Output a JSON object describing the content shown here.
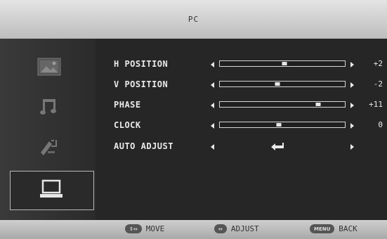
{
  "header": {
    "title": "PC"
  },
  "sidebar": {
    "items": [
      {
        "icon": "picture-icon"
      },
      {
        "icon": "music-icon"
      },
      {
        "icon": "tools-icon"
      },
      {
        "icon": "laptop-icon",
        "selected": true
      }
    ]
  },
  "menu": {
    "rows": [
      {
        "label": "H POSITION",
        "value": "+2",
        "level": 0.52
      },
      {
        "label": "V POSITION",
        "value": "-2",
        "level": 0.46
      },
      {
        "label": "PHASE",
        "value": "+11",
        "level": 0.8
      },
      {
        "label": "CLOCK",
        "value": "0",
        "level": 0.47
      },
      {
        "label": "AUTO ADJUST",
        "value": ""
      }
    ]
  },
  "footer": {
    "move_key": "↕↔",
    "move_label": "MOVE",
    "adjust_key": "↔",
    "adjust_label": "ADJUST",
    "back_key": "MENU",
    "back_label": "BACK"
  }
}
